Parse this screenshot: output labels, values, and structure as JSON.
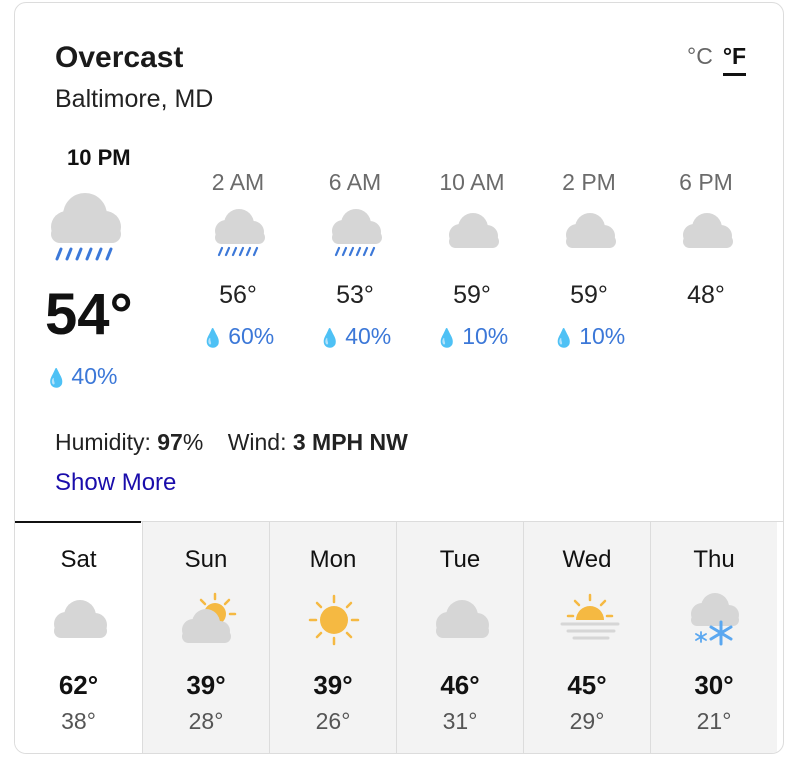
{
  "header": {
    "condition": "Overcast",
    "location": "Baltimore, MD",
    "unit_c": "°C",
    "unit_f": "°F",
    "selected_unit": "F"
  },
  "hourly": [
    {
      "time": "10 PM",
      "icon": "cloud-rain-icon",
      "temp": "54°",
      "precip": "40%"
    },
    {
      "time": "2 AM",
      "icon": "cloud-rain-icon",
      "temp": "56°",
      "precip": "60%"
    },
    {
      "time": "6 AM",
      "icon": "cloud-rain-icon",
      "temp": "53°",
      "precip": "40%"
    },
    {
      "time": "10 AM",
      "icon": "cloud-icon",
      "temp": "59°",
      "precip": "10%"
    },
    {
      "time": "2 PM",
      "icon": "cloud-icon",
      "temp": "59°",
      "precip": "10%"
    },
    {
      "time": "6 PM",
      "icon": "cloud-icon",
      "temp": "48°",
      "precip": ""
    }
  ],
  "details": {
    "humidity_label": "Humidity:",
    "humidity_value": "97",
    "humidity_unit": "%",
    "wind_label": "Wind:",
    "wind_value": "3 MPH NW",
    "show_more": "Show More"
  },
  "daily": [
    {
      "day": "Sat",
      "icon": "cloud-icon",
      "hi": "62°",
      "lo": "38°"
    },
    {
      "day": "Sun",
      "icon": "partly-cloudy-icon",
      "hi": "39°",
      "lo": "28°"
    },
    {
      "day": "Mon",
      "icon": "sun-icon",
      "hi": "39°",
      "lo": "26°"
    },
    {
      "day": "Tue",
      "icon": "cloud-icon",
      "hi": "46°",
      "lo": "31°"
    },
    {
      "day": "Wed",
      "icon": "sun-fog-icon",
      "hi": "45°",
      "lo": "29°"
    },
    {
      "day": "Thu",
      "icon": "cloud-snow-icon",
      "hi": "30°",
      "lo": "21°"
    }
  ],
  "colors": {
    "precip_blue": "#3c78d8",
    "link_blue": "#1a0dab",
    "cloud_gray": "#d6d6d6",
    "sun_yellow": "#f5b942",
    "snow_blue": "#5aa7f0"
  }
}
